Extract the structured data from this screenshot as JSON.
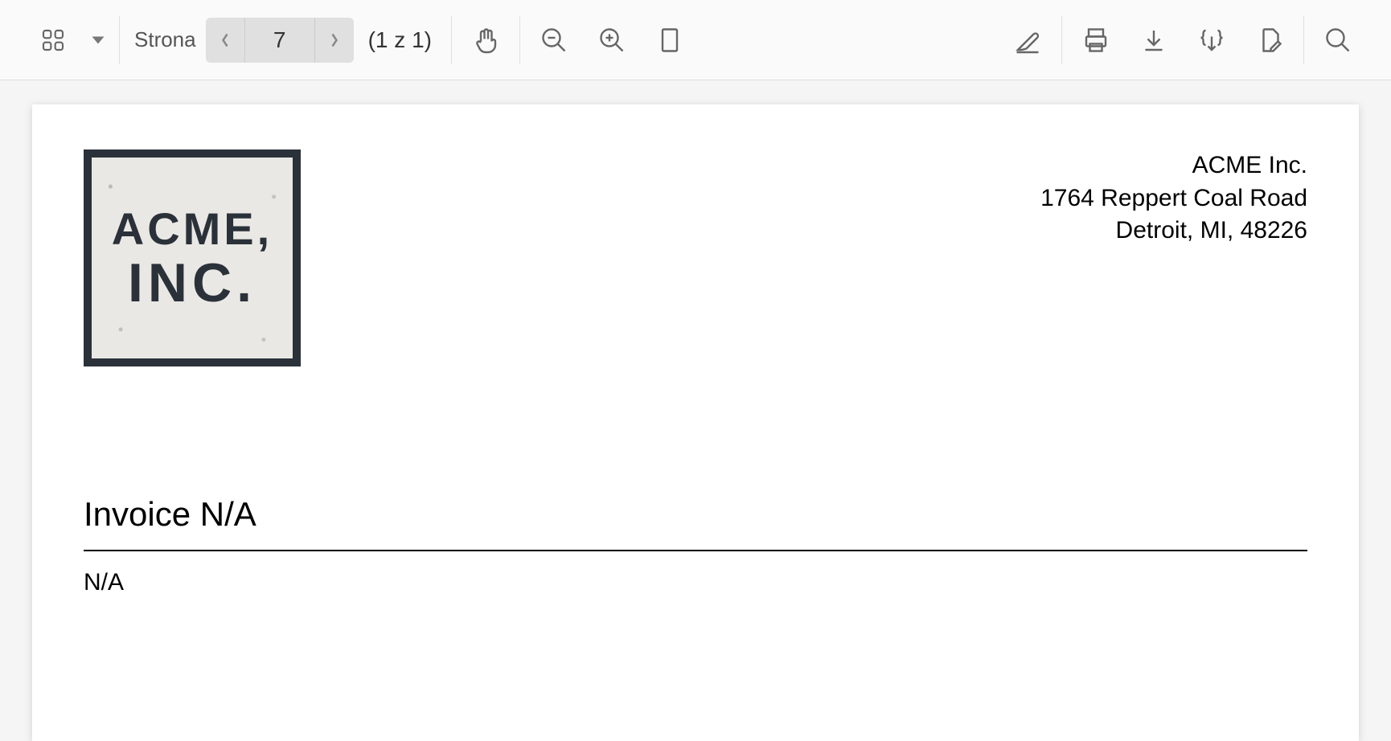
{
  "toolbar": {
    "page_label": "Strona",
    "page_input_value": "7",
    "page_count_text": "(1 z 1)"
  },
  "document": {
    "logo": {
      "line1": "ACME,",
      "line2": "INC."
    },
    "company": {
      "name": "ACME Inc.",
      "street": "1764 Reppert Coal Road",
      "city_state_zip": "Detroit, MI, 48226"
    },
    "invoice_title": "Invoice N/A",
    "invoice_sub": "N/A"
  }
}
